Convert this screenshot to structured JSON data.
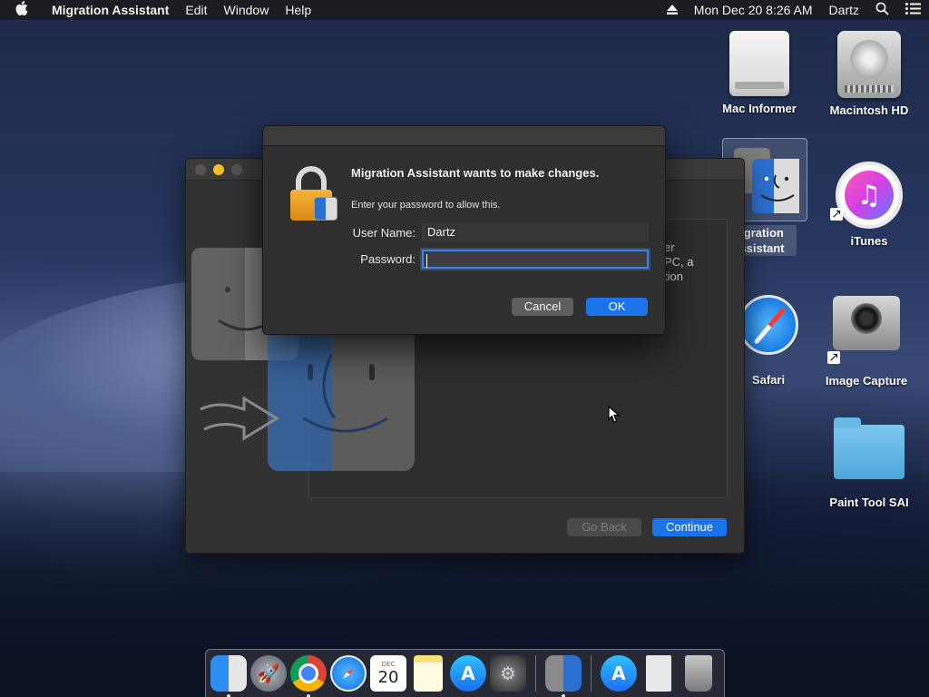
{
  "menubar": {
    "app_name": "Migration Assistant",
    "menus": [
      "Edit",
      "Window",
      "Help"
    ],
    "clock": "Mon Dec 20  8:26 AM",
    "user": "Dartz"
  },
  "desktop": {
    "icons": [
      {
        "label": "Mac Informer",
        "icon": "drive-icon"
      },
      {
        "label": "Macintosh HD",
        "icon": "hard-drive-icon"
      },
      {
        "label": "Migration Assistant",
        "label_visible": "igration\nssistant",
        "icon": "migration-assistant-icon"
      },
      {
        "label": "iTunes",
        "icon": "itunes-icon"
      },
      {
        "label": "Safari",
        "icon": "safari-icon"
      },
      {
        "label": "Image Capture",
        "icon": "image-capture-icon"
      },
      {
        "label": "Paint Tool SAI",
        "icon": "folder-icon"
      }
    ]
  },
  "main_window": {
    "partial_text": [
      "er",
      "PC, a",
      "tion"
    ],
    "go_back_label": "Go Back",
    "continue_label": "Continue"
  },
  "auth_dialog": {
    "title": "Migration Assistant wants to make changes.",
    "subtitle": "Enter your password to allow this.",
    "username_label": "User Name:",
    "username_value": "Dartz",
    "password_label": "Password:",
    "password_value": "",
    "cancel_label": "Cancel",
    "ok_label": "OK"
  },
  "dock": {
    "items": [
      "Finder",
      "Launchpad",
      "Google Chrome",
      "Safari",
      "Calendar",
      "Notes",
      "App Store",
      "System Preferences",
      "Migration Assistant",
      "App Store Downloads",
      "Document",
      "Trash"
    ],
    "calendar_month": "DEC",
    "calendar_day": "20"
  },
  "colors": {
    "accent": "#1a73e8",
    "window_bg": "#323232",
    "dialog_bg": "#2f2f2f",
    "focus_ring": "#3c82e6"
  }
}
